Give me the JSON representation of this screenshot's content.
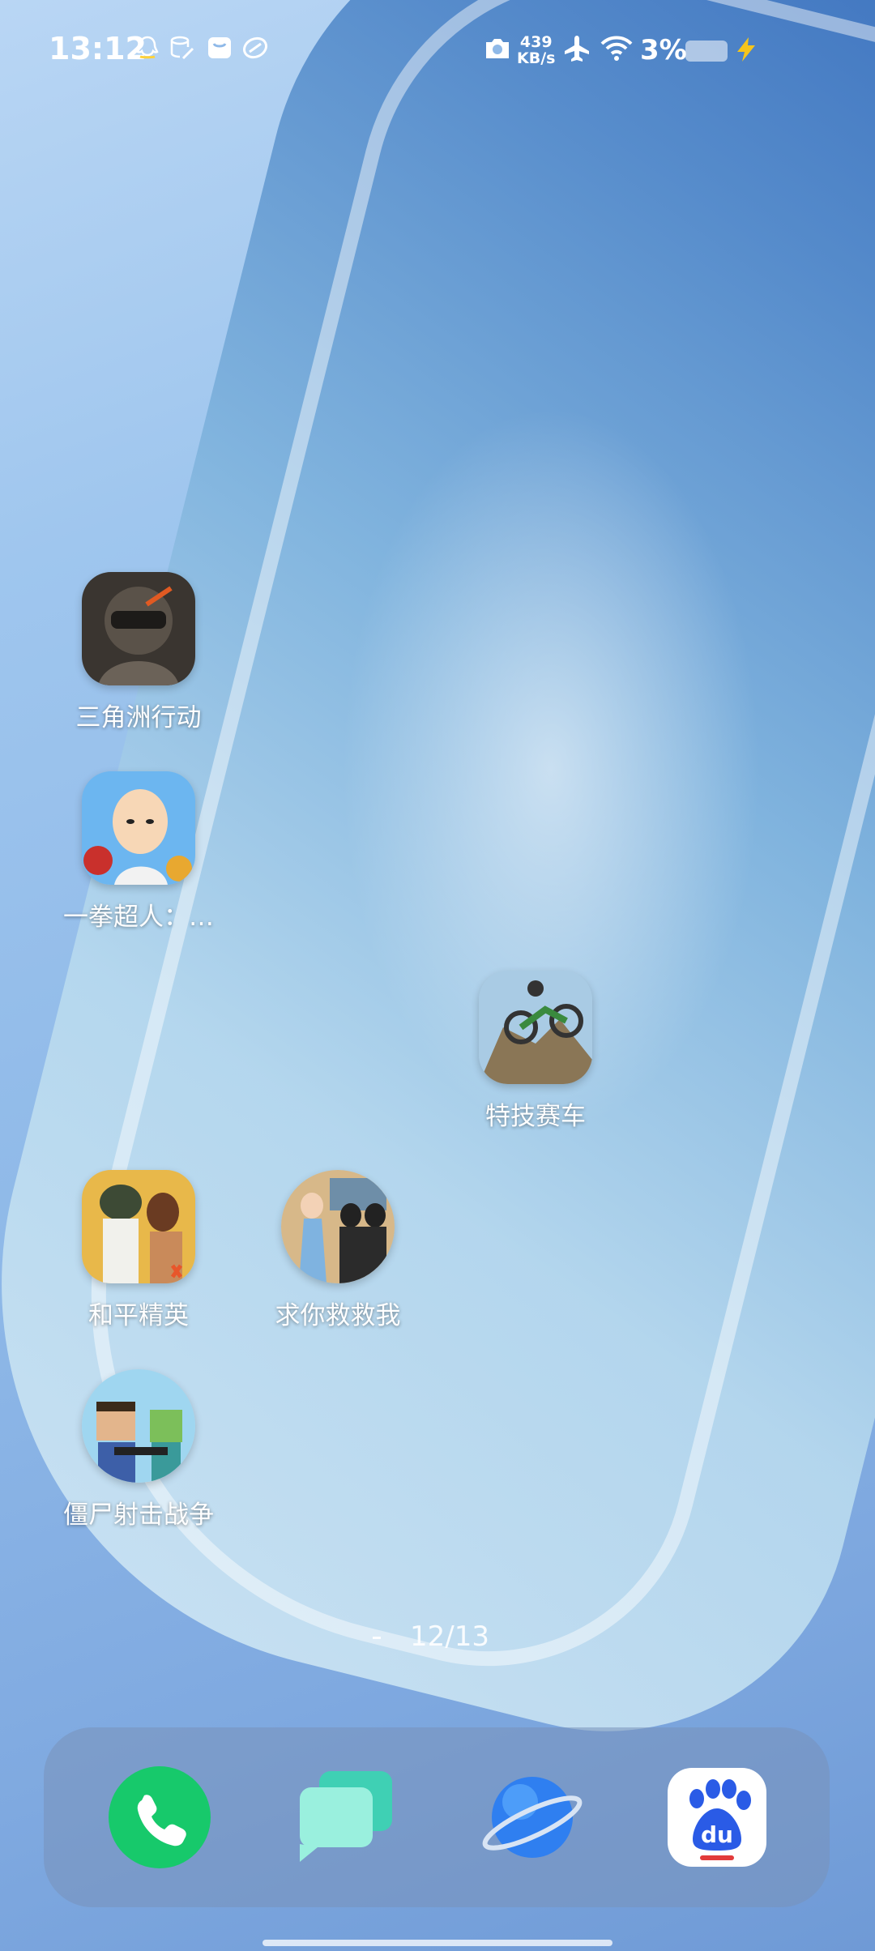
{
  "status_bar": {
    "time": "13:12",
    "network_speed_value": "439",
    "network_speed_unit": "KB/s",
    "battery_percent": "3%",
    "notification_icons": [
      "qq-icon",
      "database-icon",
      "mail-icon",
      "badge-icon"
    ],
    "system_icons": [
      "camera-icon",
      "airplane-mode-icon",
      "wifi-icon",
      "battery-icon",
      "charging-icon"
    ]
  },
  "home": {
    "apps": [
      {
        "label": "三角洲行动",
        "icon": "soldier-game-icon"
      },
      {
        "label": "一拳超人：…",
        "icon": "anime-hero-game-icon"
      },
      {
        "label": "特技赛车",
        "icon": "motorbike-game-icon"
      },
      {
        "label": "和平精英",
        "icon": "battle-royale-game-icon"
      },
      {
        "label": "求你救救我",
        "icon": "rescue-game-icon"
      },
      {
        "label": "僵尸射击战争",
        "icon": "blocky-shooter-game-icon"
      }
    ],
    "page_indicator": "12/13"
  },
  "dock": {
    "items": [
      {
        "name": "phone",
        "icon": "phone-icon",
        "color": "#17c96b"
      },
      {
        "name": "messages",
        "icon": "messages-icon",
        "color": "#7ee7d6"
      },
      {
        "name": "browser",
        "icon": "planet-browser-icon",
        "color": "#2f7ff0"
      },
      {
        "name": "baidu",
        "icon": "baidu-paw-icon",
        "color": "#2a5be6"
      }
    ]
  }
}
